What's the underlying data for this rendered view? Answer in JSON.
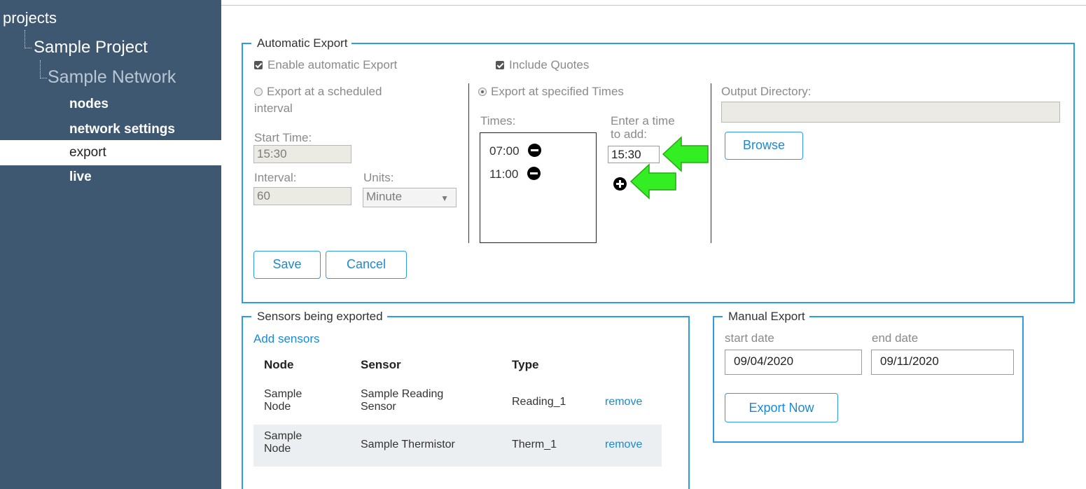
{
  "sidebar": {
    "root": "projects",
    "project": "Sample Project",
    "network": "Sample Network",
    "items": [
      {
        "label": "nodes"
      },
      {
        "label": "network settings"
      },
      {
        "label": "export"
      },
      {
        "label": "live"
      }
    ]
  },
  "auto_export": {
    "legend": "Automatic Export",
    "enable_label": "Enable automatic Export",
    "include_quotes_label": "Include Quotes",
    "scheduled_label_1": "Export at a scheduled",
    "scheduled_label_2": "interval",
    "start_time_label": "Start Time:",
    "start_time_value": "15:30",
    "interval_label": "Interval:",
    "interval_value": "60",
    "units_label": "Units:",
    "units_value": "Minute",
    "specified_label": "Export at specified Times",
    "times_label": "Times:",
    "times": [
      "07:00",
      "11:00"
    ],
    "enter_time_label_1": "Enter a time",
    "enter_time_label_2": "to add:",
    "enter_time_value": "15:30",
    "output_dir_label": "Output Directory:",
    "output_dir_value": "",
    "browse_label": "Browse",
    "save_label": "Save",
    "cancel_label": "Cancel"
  },
  "sensors": {
    "legend": "Sensors being exported",
    "add_label": "Add sensors",
    "headers": [
      "Node",
      "Sensor",
      "Type"
    ],
    "rows": [
      {
        "node_1": "Sample",
        "node_2": "Node",
        "sensor_1": "Sample Reading",
        "sensor_2": "Sensor",
        "type": "Reading_1",
        "action": "remove"
      },
      {
        "node_1": "Sample",
        "node_2": "Node",
        "sensor_1": "Sample Thermistor",
        "sensor_2": "",
        "type": "Therm_1",
        "action": "remove"
      }
    ]
  },
  "manual_export": {
    "legend": "Manual Export",
    "start_label": "start date",
    "end_label": "end date",
    "start_value": "09/04/2020",
    "end_value": "09/11/2020",
    "export_label": "Export Now"
  },
  "colors": {
    "sidebar_bg": "#3e5871",
    "accent": "#2e9be6",
    "arrow": "#33ee22"
  }
}
